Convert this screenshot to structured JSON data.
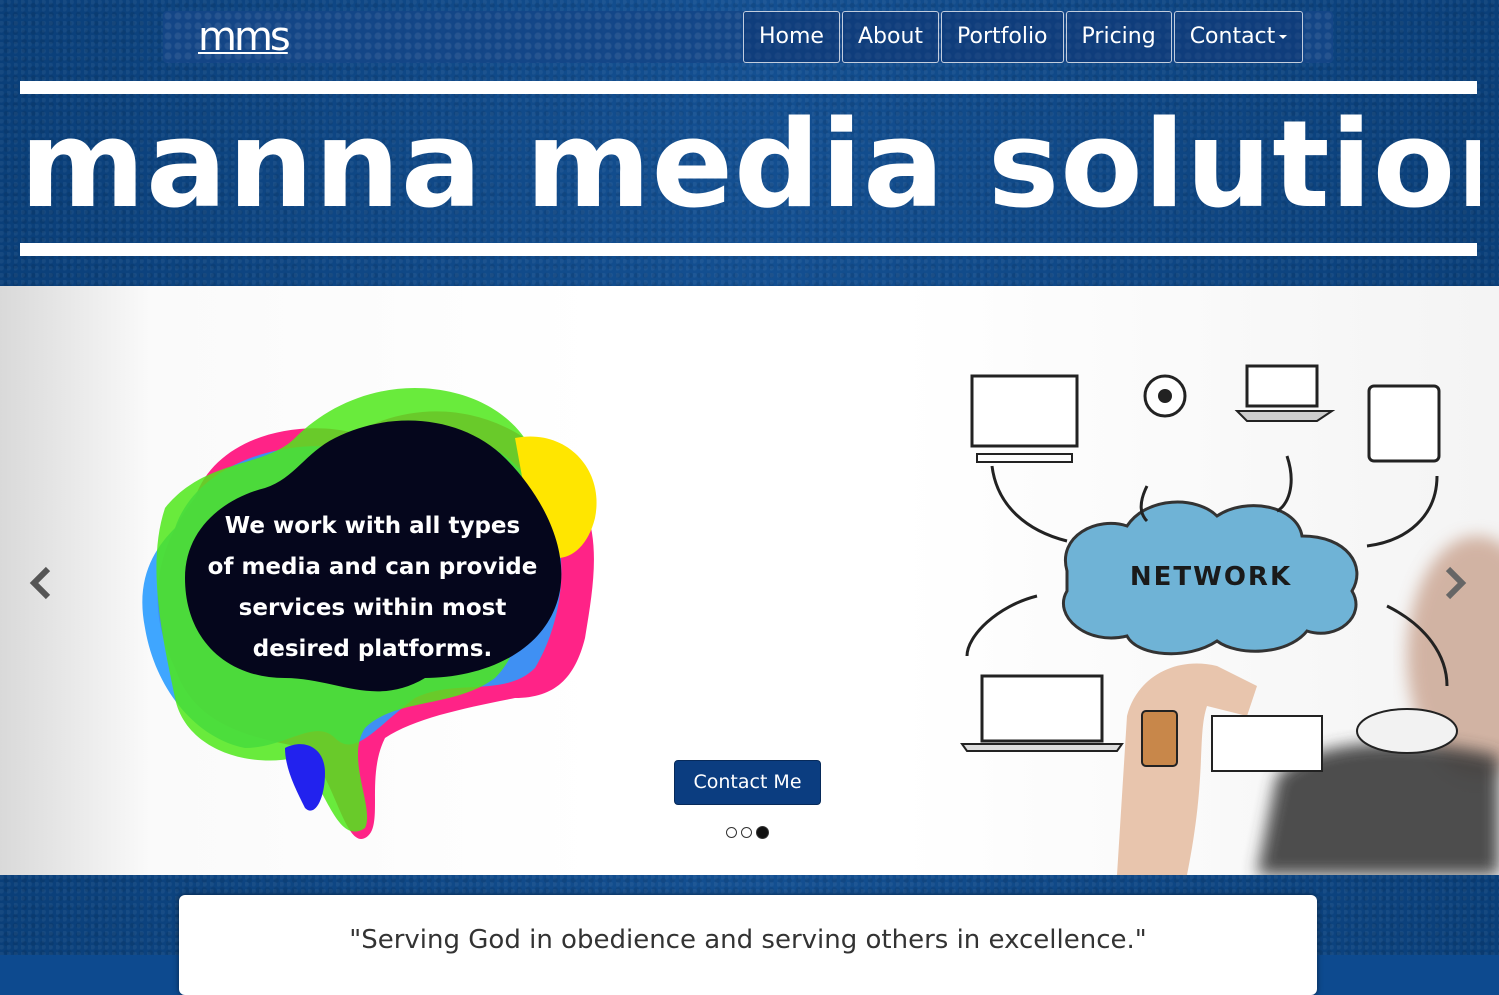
{
  "header": {
    "logo_text": "mms",
    "brand_title": "manna media solutions"
  },
  "nav": {
    "items": [
      {
        "label": "Home"
      },
      {
        "label": "About"
      },
      {
        "label": "Portfolio"
      },
      {
        "label": "Pricing"
      },
      {
        "label": "Contact",
        "has_dropdown": true
      }
    ]
  },
  "carousel": {
    "prev_icon": "chevron-left-icon",
    "next_icon": "chevron-right-icon",
    "blob_text_lines": [
      "We work with all types",
      "of media and can provide",
      "services within most",
      "desired platforms."
    ],
    "contact_button_label": "Contact Me",
    "slide_count": 3,
    "active_slide": 3,
    "network_label": "NETWORK"
  },
  "quote": {
    "text": "\"Serving God in obedience and serving others in excellence.\""
  },
  "colors": {
    "brand_blue": "#0c4a8e",
    "button_blue": "#0b3d80",
    "white": "#ffffff"
  }
}
